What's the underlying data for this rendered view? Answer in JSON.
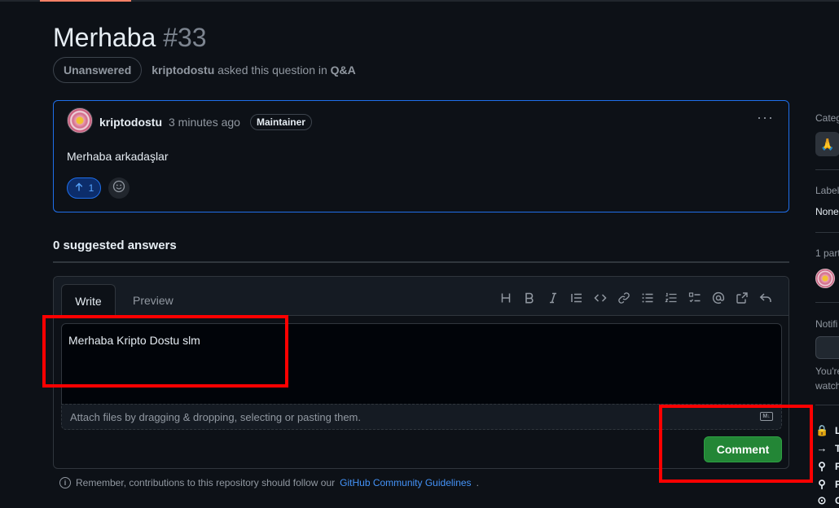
{
  "discussion": {
    "title": "Merhaba",
    "number": "#33",
    "status_badge": "Unanswered",
    "asked_by": "kriptodostu",
    "asked_text": "asked this question in",
    "category_link": "Q&A"
  },
  "post": {
    "author": "kriptodostu",
    "time": "3 minutes ago",
    "role_badge": "Maintainer",
    "body": "Merhaba arkadaşlar",
    "upvote_count": "1",
    "kebab": "···"
  },
  "answers": {
    "heading": "0 suggested answers"
  },
  "composer": {
    "tab_write": "Write",
    "tab_preview": "Preview",
    "text_value": "Merhaba Kripto Dostu slm",
    "attach_hint": "Attach files by dragging & dropping, selecting or pasting them.",
    "md_badge": "M↓",
    "comment_label": "Comment"
  },
  "guideline": {
    "text": "Remember, contributions to this repository should follow our",
    "link": "GitHub Community Guidelines",
    "tail": "."
  },
  "sidebar": {
    "category_label": "Categ",
    "category_emoji": "🙏",
    "labels_label": "Label",
    "labels_value": "None",
    "participants_label": "1 part",
    "notifications_label": "Notifi",
    "notif_text_1": "You're",
    "notif_text_2": "watch",
    "actions": [
      {
        "icon": "🔒",
        "label": "L"
      },
      {
        "icon": "→",
        "label": "T"
      },
      {
        "icon": "⚲",
        "label": "P"
      },
      {
        "icon": "⚲",
        "label": "P"
      },
      {
        "icon": "⊙",
        "label": "C"
      }
    ]
  },
  "colors": {
    "accent_blue": "#1f6feb",
    "comment_green": "#238636",
    "annotation_red": "#ff0000",
    "background": "#0d1117"
  }
}
